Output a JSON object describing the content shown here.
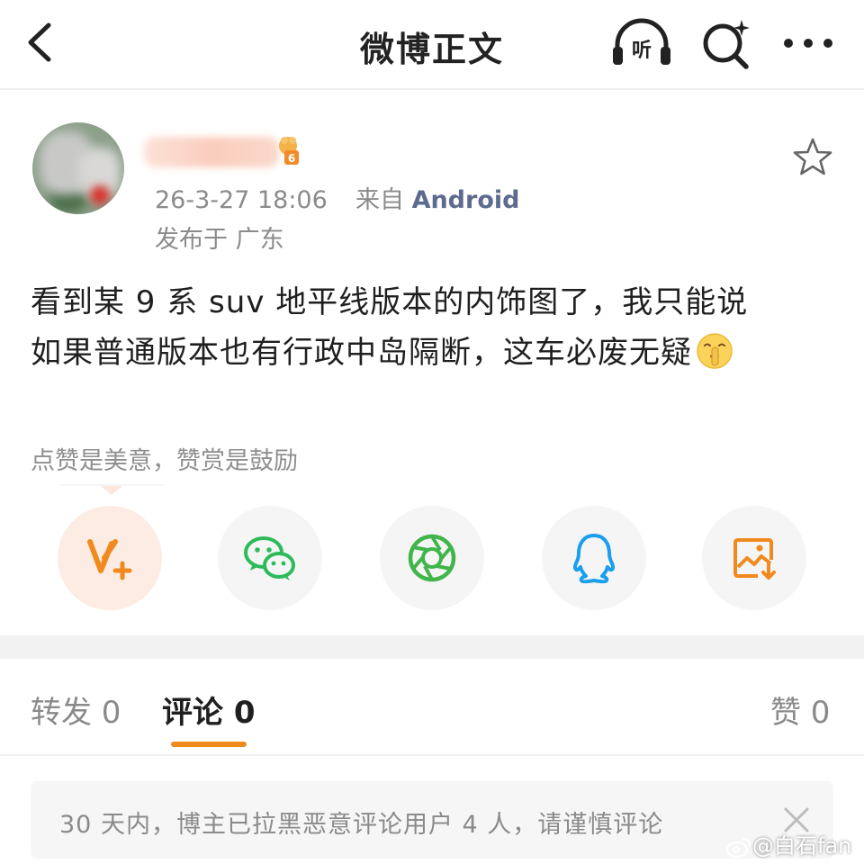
{
  "nav": {
    "title": "微博正文",
    "listen_label": "听"
  },
  "post": {
    "timestamp": "26-3-27 18:06",
    "source_prefix": "来自",
    "source": "Android",
    "location": "发布于 广东",
    "text_line1": "看到某 9 系 suv 地平线版本的内饰图了，我只能说",
    "text_line2": "如果普通版本也有行政中岛隔断，这车必废无疑",
    "emoji": "shushing-face-emoji",
    "vip_level": "6"
  },
  "reward": {
    "hint": "点赞是美意，赞赏是鼓励"
  },
  "share": {
    "items": [
      {
        "icon": "reward-v-plus-icon",
        "color": "#f08a1f"
      },
      {
        "icon": "wechat-icon",
        "color": "#2dbb5a"
      },
      {
        "icon": "moments-icon",
        "color": "#40b54a"
      },
      {
        "icon": "qq-icon",
        "color": "#1a9ef0"
      },
      {
        "icon": "save-image-icon",
        "color": "#f08a1f"
      }
    ]
  },
  "tabs": {
    "repost": "转发 0",
    "comment": "评论 0",
    "like": "赞 0",
    "active": "comment",
    "accent": "#f08a1f"
  },
  "notice": {
    "text": "30 天内，博主已拉黑恶意评论用户 4 人，请谨慎评论"
  },
  "watermark": {
    "text": "@白石fan"
  }
}
